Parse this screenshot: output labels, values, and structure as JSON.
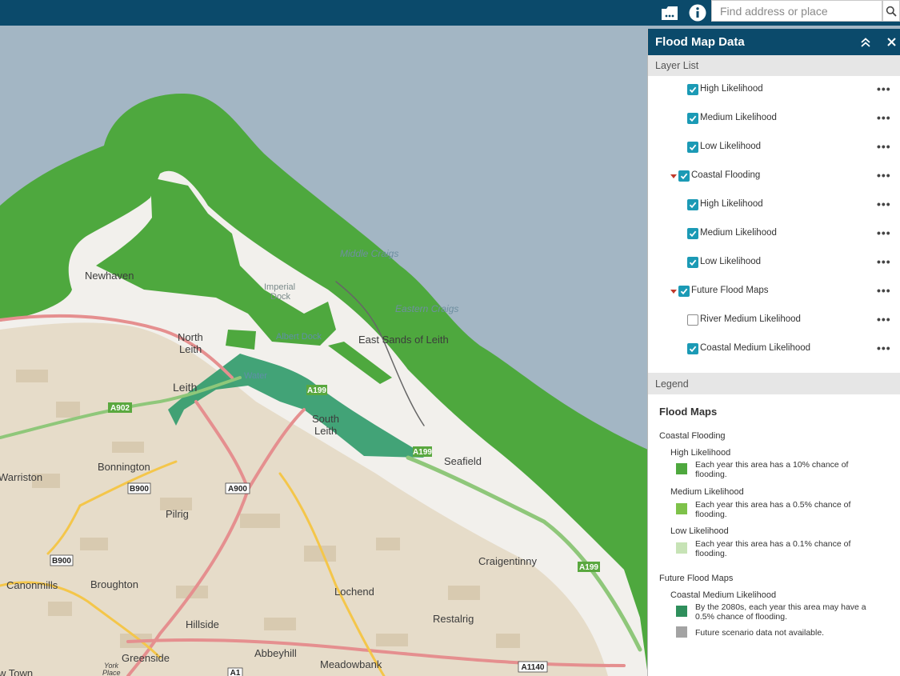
{
  "toolbar": {
    "search_placeholder": "Find address or place",
    "icons": [
      "layers-icon",
      "info-icon",
      "search-icon"
    ]
  },
  "map": {
    "place_labels": [
      "Newhaven",
      "North",
      "Leith",
      "Leith",
      "South",
      "Leith",
      "Bonnington",
      "Warriston",
      "Seafield",
      "Pilrig",
      "Craigentinny",
      "Canonmills",
      "Broughton",
      "Lochend",
      "Restalrig",
      "Hillside",
      "Abbeyhill",
      "Greenside",
      "Meadowbank",
      "York",
      "Place",
      "w Town",
      "Imperial",
      "Dock",
      "Albert Dock",
      "East Sands of Leith",
      "Water"
    ],
    "water_labels": [
      "Middle Craigs",
      "Eastern Craigs"
    ],
    "road_labels": [
      "A902",
      "A199",
      "A199",
      "B900",
      "A900",
      "B900",
      "A199",
      "A1",
      "A1140"
    ],
    "colors": {
      "sea": "#a3b6c4",
      "land": "#f2f0ec",
      "coastal_high": "#4ea83e",
      "coastal_future": "#2f9a6a",
      "road_major": "#e58f8f",
      "road_secondary": "#f4c64a"
    }
  },
  "panel": {
    "title": "Flood Map Data",
    "layer_list_label": "Layer List",
    "layers": [
      {
        "label": "High Likelihood",
        "checked": true,
        "indent": 2,
        "caret": false
      },
      {
        "label": "Medium Likelihood",
        "checked": true,
        "indent": 2,
        "caret": false
      },
      {
        "label": "Low Likelihood",
        "checked": true,
        "indent": 2,
        "caret": false
      },
      {
        "label": "Coastal Flooding",
        "checked": true,
        "indent": 1,
        "caret": true
      },
      {
        "label": "High Likelihood",
        "checked": true,
        "indent": 2,
        "caret": false
      },
      {
        "label": "Medium Likelihood",
        "checked": true,
        "indent": 2,
        "caret": false
      },
      {
        "label": "Low Likelihood",
        "checked": true,
        "indent": 2,
        "caret": false
      },
      {
        "label": "Future Flood Maps",
        "checked": true,
        "indent": 1,
        "caret": true
      },
      {
        "label": "River Medium Likelihood",
        "checked": false,
        "indent": 2,
        "caret": false
      },
      {
        "label": "Coastal Medium Likelihood",
        "checked": true,
        "indent": 2,
        "caret": false
      }
    ],
    "more_label": "•••",
    "legend_label": "Legend",
    "legend": {
      "title": "Flood Maps",
      "coastal_group": "Coastal Flooding",
      "coastal_items": [
        {
          "label": "High Likelihood",
          "desc_1": "Each year this area has a 10% chance of",
          "desc_2": "flooding.",
          "color": "#4ea83e"
        },
        {
          "label": "Medium Likelihood",
          "desc_1": "Each year this area has a 0.5% chance of",
          "desc_2": "flooding.",
          "color": "#7ec24a"
        },
        {
          "label": "Low Likelihood",
          "desc_1": "Each year this area has a 0.1% chance of",
          "desc_2": "flooding.",
          "color": "#c7e3b6"
        }
      ],
      "future_group": "Future Flood Maps",
      "future_item": {
        "label": "Coastal Medium Likelihood",
        "desc_1": "By the 2080s, each year this area may have a",
        "desc_2": "0.5% chance of flooding.",
        "color": "#2f8f5c"
      },
      "na_item": {
        "desc": "Future scenario data not available.",
        "color": "#a3a3a3"
      }
    }
  }
}
